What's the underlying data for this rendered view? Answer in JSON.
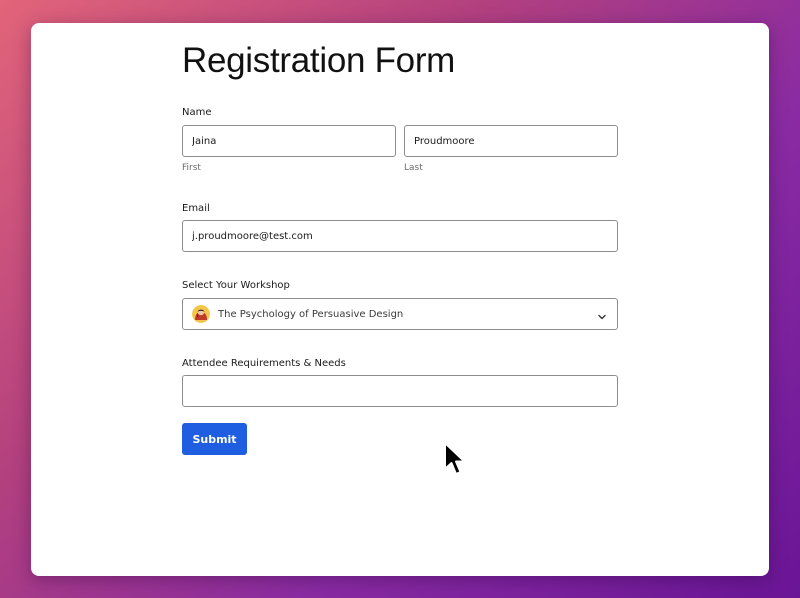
{
  "form": {
    "title": "Registration Form",
    "name": {
      "label": "Name",
      "first_value": "Jaina",
      "first_sublabel": "First",
      "last_value": "Proudmoore",
      "last_sublabel": "Last"
    },
    "email": {
      "label": "Email",
      "value": "j.proudmoore@test.com"
    },
    "workshop": {
      "label": "Select Your Workshop",
      "selected": "The Psychology of Persuasive Design",
      "icon": "avatar-icon",
      "chevron_icon": "chevron-down-icon"
    },
    "requirements": {
      "label": "Attendee Requirements & Needs",
      "value": ""
    },
    "submit_label": "Submit"
  },
  "colors": {
    "accent": "#1f5ee0",
    "background_gradient_start": "#e2647a",
    "background_gradient_end": "#6a1596",
    "border": "#8d8d8d"
  }
}
